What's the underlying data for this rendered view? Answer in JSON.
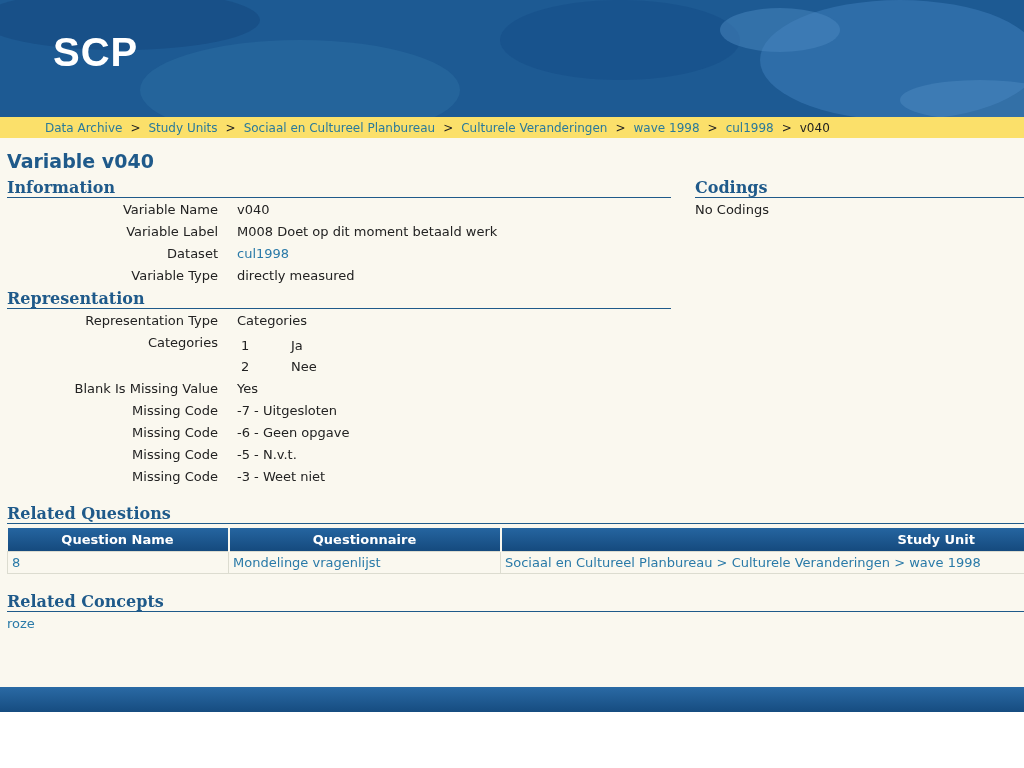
{
  "header": {
    "logo": "SCP"
  },
  "breadcrumb": {
    "items": [
      {
        "label": "Data Archive",
        "link": true
      },
      {
        "label": "Study Units",
        "link": true
      },
      {
        "label": "Sociaal en Cultureel Planbureau",
        "link": true
      },
      {
        "label": "Culturele Veranderingen",
        "link": true
      },
      {
        "label": "wave 1998",
        "link": true
      },
      {
        "label": "cul1998",
        "link": true
      },
      {
        "label": "v040",
        "link": false
      }
    ],
    "separators": [
      ">",
      ">",
      ">",
      ">",
      ">",
      ">"
    ]
  },
  "title": "Variable v040",
  "information": {
    "heading": "Information",
    "rows": [
      {
        "label": "Variable Name",
        "kind": "text",
        "value": "v040"
      },
      {
        "label": "Variable Label",
        "kind": "text",
        "value": "M008 Doet op dit moment betaald werk"
      },
      {
        "label": "Dataset",
        "kind": "link",
        "value": "cul1998"
      },
      {
        "label": "Variable Type",
        "kind": "text",
        "value": "directly measured"
      }
    ]
  },
  "representation": {
    "heading": "Representation",
    "rows": [
      {
        "label": "Representation Type",
        "kind": "text",
        "value": "Categories"
      },
      {
        "label": "Categories",
        "kind": "categories",
        "categories": [
          {
            "code": "1",
            "label": "Ja"
          },
          {
            "code": "2",
            "label": "Nee"
          }
        ]
      },
      {
        "label": "Blank Is Missing Value",
        "kind": "text",
        "value": "Yes"
      },
      {
        "label": "Missing Code",
        "kind": "text",
        "value": "-7 - Uitgesloten"
      },
      {
        "label": "Missing Code",
        "kind": "text",
        "value": "-6 - Geen opgave"
      },
      {
        "label": "Missing Code",
        "kind": "text",
        "value": "-5 - N.v.t."
      },
      {
        "label": "Missing Code",
        "kind": "text",
        "value": "-3 - Weet niet"
      }
    ]
  },
  "codings": {
    "heading": "Codings",
    "text": "No Codings"
  },
  "related_questions": {
    "heading": "Related Questions",
    "columns": [
      "Question Name",
      "Questionnaire",
      "Study Unit"
    ],
    "rows": [
      [
        "8",
        "Mondelinge vragenlijst",
        "Sociaal en Cultureel Planbureau > Culturele Veranderingen > wave 1998"
      ]
    ]
  },
  "related_concepts": {
    "heading": "Related Concepts",
    "items": [
      "roze"
    ]
  }
}
